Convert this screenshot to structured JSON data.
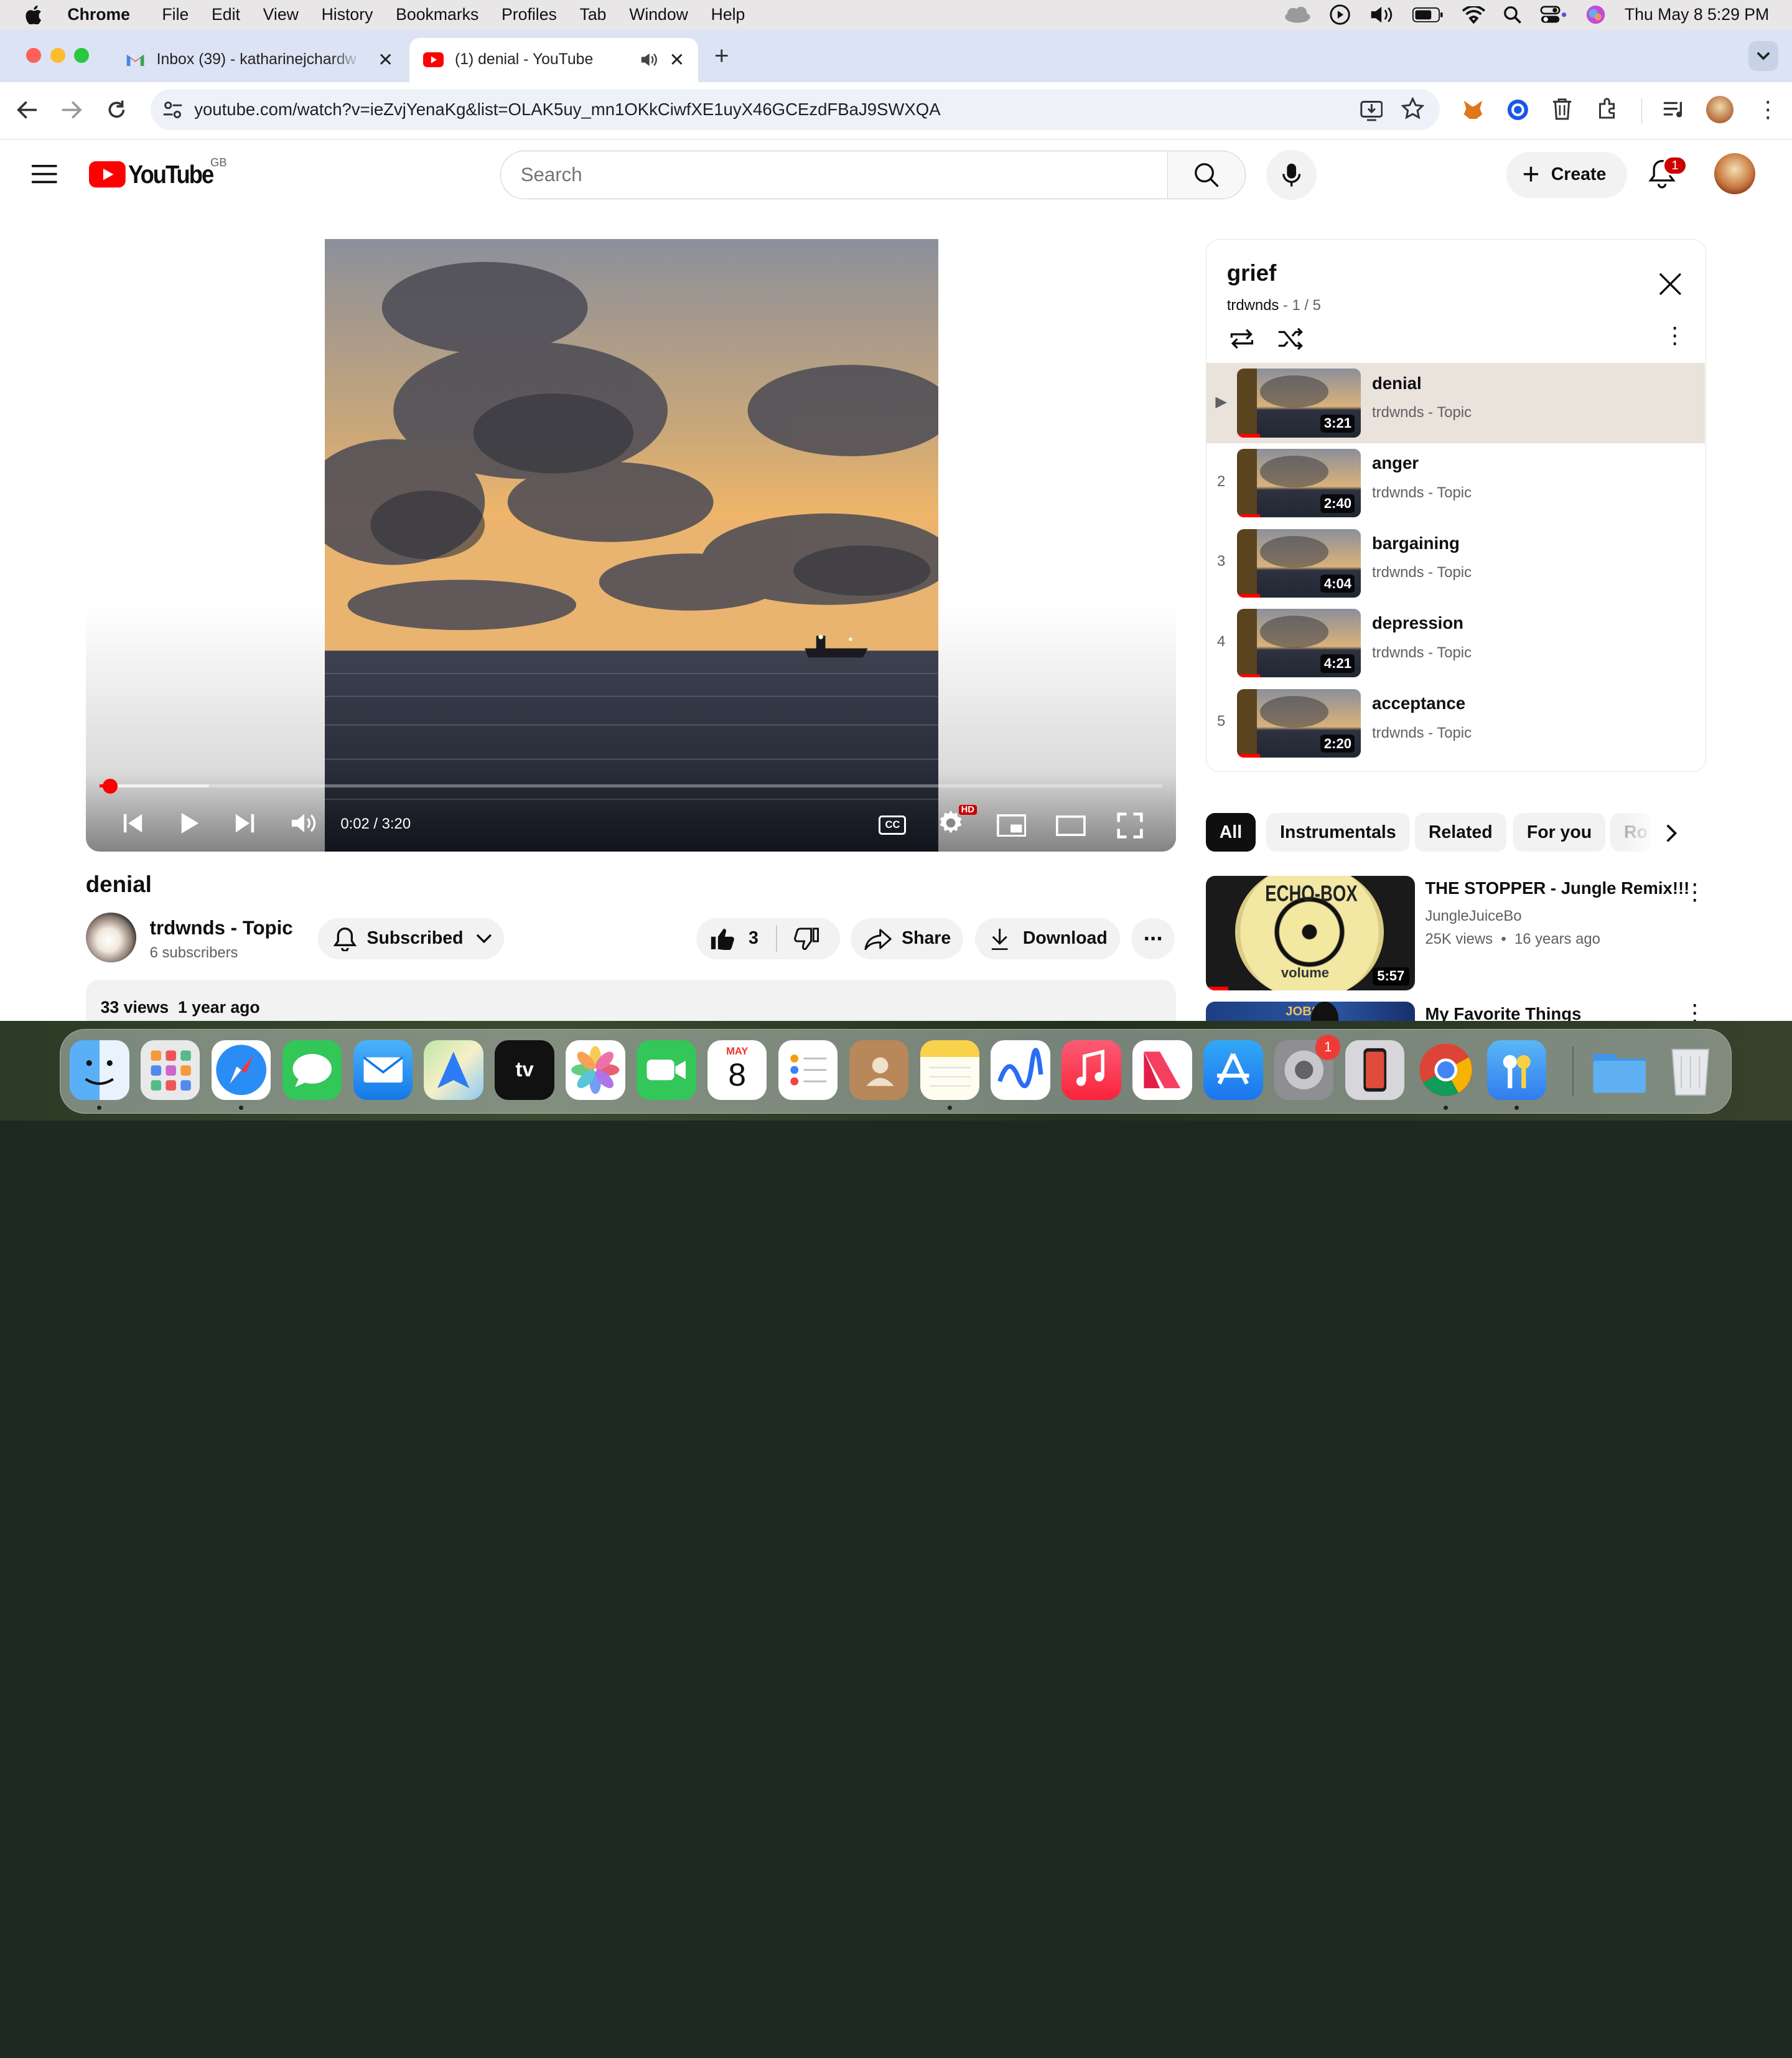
{
  "menubar": {
    "app": "Chrome",
    "items": [
      "File",
      "Edit",
      "View",
      "History",
      "Bookmarks",
      "Profiles",
      "Tab",
      "Window",
      "Help"
    ],
    "clock": "Thu May 8  5:29 PM"
  },
  "tabs": [
    {
      "title": "Inbox (39) - katharinejchardw"
    },
    {
      "title": "(1) denial - YouTube"
    }
  ],
  "omnibox": {
    "url": "youtube.com/watch?v=ieZvjYenaKg&list=OLAK5uy_mn1OKkCiwfXE1uyX46GCEzdFBaJ9SWXQA"
  },
  "youtube": {
    "region": "GB",
    "search_placeholder": "Search",
    "create": "Create",
    "notif_count": "1"
  },
  "player": {
    "time": "0:02 / 3:20",
    "progress": 0.01,
    "hd": "HD",
    "cc": "CC"
  },
  "video": {
    "title": "denial",
    "channel": "trdwnds - Topic",
    "subscribers": "6 subscribers",
    "subscribed": "Subscribed",
    "likes": "3",
    "share": "Share",
    "download": "Download",
    "views": "33 views",
    "age": "1 year ago"
  },
  "playlist": {
    "title": "grief",
    "channel": "trdwnds",
    "sep": " - ",
    "position": "1 / 5",
    "items": [
      {
        "idx": "▶",
        "title": "denial",
        "channel": "trdwnds - Topic",
        "dur": "3:21"
      },
      {
        "idx": "2",
        "title": "anger",
        "channel": "trdwnds - Topic",
        "dur": "2:40"
      },
      {
        "idx": "3",
        "title": "bargaining",
        "channel": "trdwnds - Topic",
        "dur": "4:04"
      },
      {
        "idx": "4",
        "title": "depression",
        "channel": "trdwnds - Topic",
        "dur": "4:21"
      },
      {
        "idx": "5",
        "title": "acceptance",
        "channel": "trdwnds - Topic",
        "dur": "2:20"
      }
    ]
  },
  "chips": [
    "All",
    "Instrumentals",
    "Related",
    "For you",
    "Ro"
  ],
  "recs": [
    {
      "title": "THE STOPPER - Jungle Remix!!!",
      "channel": "JungleJuiceBo",
      "meta": "25K views  •  16 years ago",
      "dur": "5:57",
      "thumb_text": "ECHO-BOX",
      "thumb_sub": "volume"
    },
    {
      "title": "My Favorite Things",
      "thumb_text": "JOBS"
    }
  ],
  "dock": {
    "calendar_month": "MAY",
    "calendar_day": "8",
    "settings_badge": "1"
  },
  "colors": {
    "yt_red": "#ff0000",
    "accent": "#065fd4"
  }
}
